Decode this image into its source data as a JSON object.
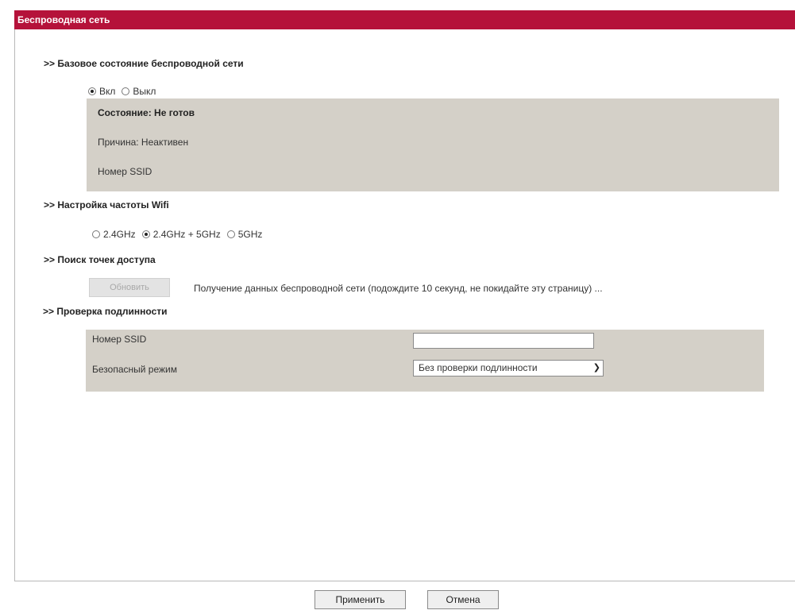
{
  "page": {
    "title": "Беспроводная сеть"
  },
  "basic_status": {
    "header": ">> Базовое состояние беспроводной сети",
    "on_label": "Вкл",
    "off_label": "Выкл",
    "selected": "on",
    "status_label": "Состояние: Не готов",
    "reason_label": "Причина: Неактивен",
    "ssid_label": "Номер SSID"
  },
  "frequency": {
    "header": ">> Настройка частоты Wifi",
    "options": [
      "2.4GHz",
      "2.4GHz + 5GHz",
      "5GHz"
    ],
    "selected_index": 1
  },
  "access_points": {
    "header": ">> Поиск точек доступа",
    "refresh_label": "Обновить",
    "scan_message": "Получение данных беспроводной сети (подождите 10 секунд, не покидайте эту страницу) ..."
  },
  "authentication": {
    "header": ">> Проверка подлинности",
    "ssid_label": "Номер SSID",
    "ssid_value": "",
    "security_label": "Безопасный режим",
    "security_value": "Без проверки подлинности"
  },
  "footer": {
    "apply_label": "Применить",
    "cancel_label": "Отмена"
  },
  "colors": {
    "title_bar": "#b5123a",
    "panel_grey": "#d4d0c8"
  }
}
